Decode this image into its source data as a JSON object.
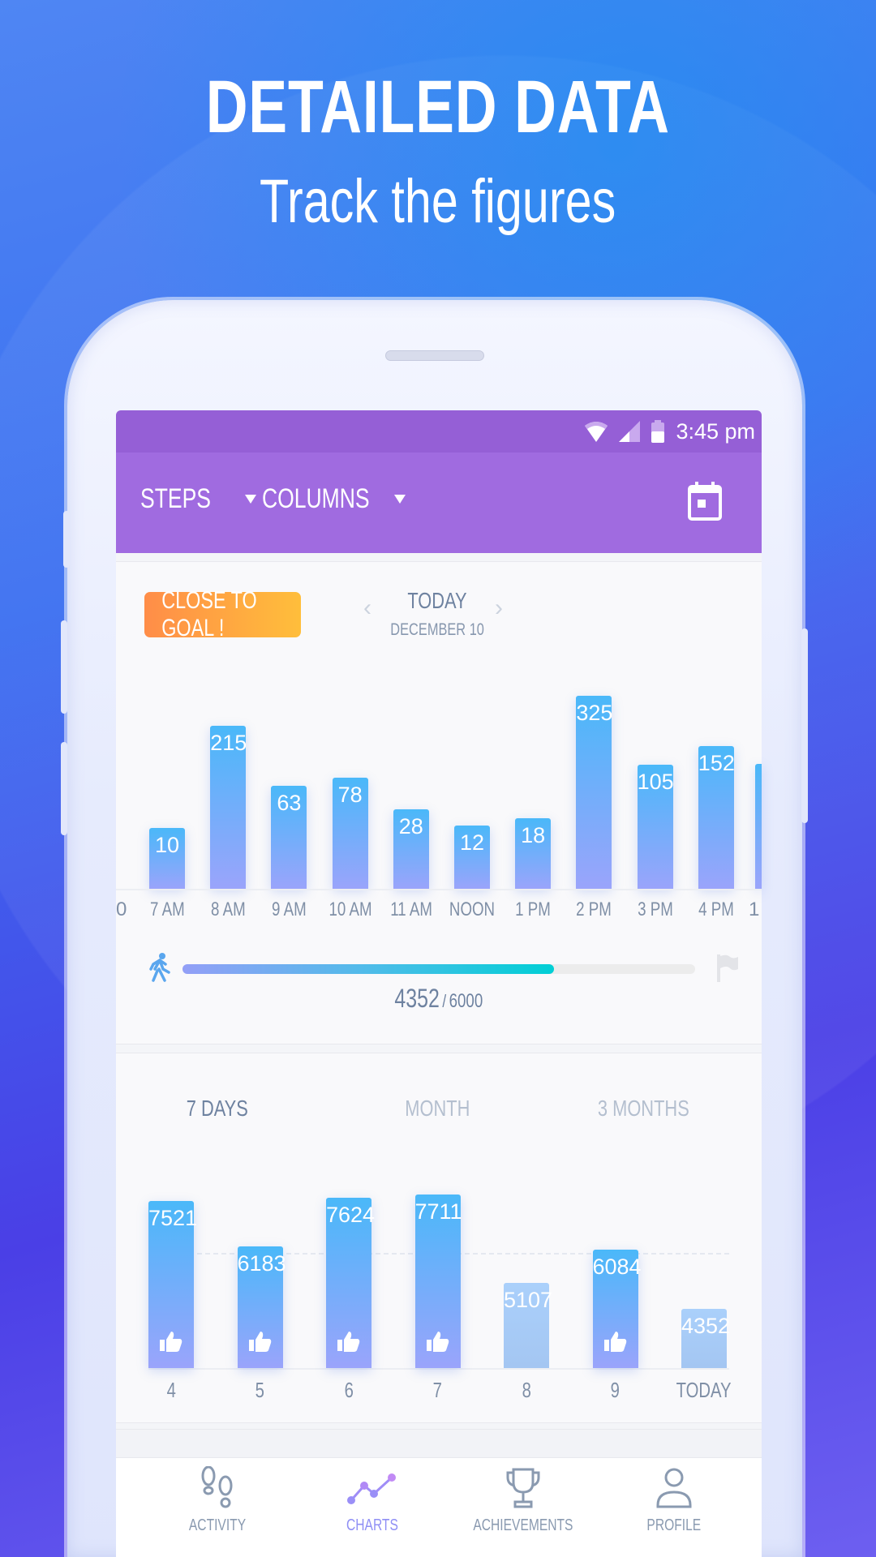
{
  "hero": {
    "title": "DETAILED DATA",
    "subtitle": "Track the figures"
  },
  "status_bar": {
    "time": "3:45 pm",
    "icons": [
      "wifi-icon",
      "signal-icon",
      "battery-icon"
    ]
  },
  "app_bar": {
    "metric_dropdown": "STEPS",
    "view_dropdown": "COLUMNS",
    "calendar_icon": "calendar-icon"
  },
  "daily": {
    "badge": "CLOSE TO GOAL !",
    "badge_colors": [
      "#ff8d48",
      "#ffbe3b"
    ],
    "day": "TODAY",
    "date": "DECEMBER 10",
    "progress": {
      "value": "4352",
      "goal": "6000",
      "separator": "/",
      "fill_color": "#00cfd5"
    }
  },
  "chart_data": [
    {
      "type": "bar",
      "title": "",
      "categories": [
        "7 AM",
        "8 AM",
        "9 AM",
        "10 AM",
        "11 AM",
        "NOON",
        "1 PM",
        "2 PM",
        "3 PM",
        "4 PM"
      ],
      "values": [
        10,
        215,
        63,
        78,
        28,
        12,
        18,
        325,
        105,
        152
      ],
      "partial_left_label": "0",
      "partial_right_label": "1",
      "bar_color": [
        "#4ab8f9",
        "#9aa4fb"
      ]
    },
    {
      "type": "bar",
      "title": "",
      "categories": [
        "4",
        "5",
        "6",
        "7",
        "8",
        "9",
        "TODAY"
      ],
      "values": [
        7521,
        6183,
        7624,
        7711,
        5107,
        6084,
        4352
      ],
      "goal": 6000,
      "goal_met": [
        true,
        true,
        true,
        true,
        false,
        true,
        false
      ]
    }
  ],
  "range_tabs": [
    {
      "label": "7 DAYS",
      "active": true
    },
    {
      "label": "MONTH",
      "active": false
    },
    {
      "label": "3 MONTHS",
      "active": false
    }
  ],
  "bottom_nav": [
    {
      "label": "ACTIVITY",
      "icon": "footprints-icon"
    },
    {
      "label": "CHARTS",
      "icon": "line-chart-icon",
      "active": true
    },
    {
      "label": "ACHIEVEMENTS",
      "icon": "trophy-icon"
    },
    {
      "label": "PROFILE",
      "icon": "person-icon"
    }
  ]
}
